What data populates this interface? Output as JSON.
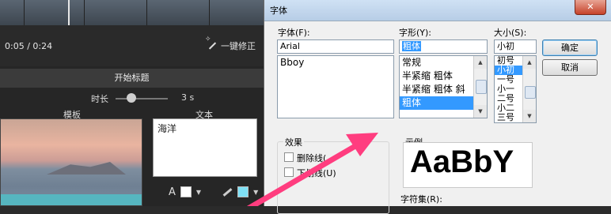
{
  "editor": {
    "time": "0:05 / 0:24",
    "auto_fix": "一键修正",
    "title_panel": "开始标题",
    "duration_label": "时长",
    "duration_value": "3 s",
    "slider_fraction": 0.3,
    "template_label": "模板",
    "text_label": "文本",
    "text_content": "海洋",
    "text_color": "#ffffff",
    "bg_color": "#7fe0f5"
  },
  "dialog": {
    "title": "字体",
    "close": "✕",
    "font_label": "字体(F):",
    "font_value": "Arial",
    "font_list": [
      "Bboy"
    ],
    "style_label": "字形(Y):",
    "style_value": "粗体",
    "style_list": [
      "常规",
      "半紧缩 粗体",
      "半紧缩 粗体 斜",
      "粗体"
    ],
    "style_selected": 3,
    "size_label": "大小(S):",
    "size_value": "小初",
    "size_list": [
      "初号",
      "小初",
      "一号",
      "小一",
      "二号",
      "小二",
      "三号"
    ],
    "size_selected": 1,
    "ok": "确定",
    "cancel": "取消",
    "effects_label": "效果",
    "strike": "删除线(",
    "underline": "下划线(U)",
    "sample_label": "示例",
    "sample_text": "AaBbY",
    "charset_label": "字符集(R):"
  },
  "colors": {
    "accent": "#3399ff",
    "arrow": "#ff3d7f"
  }
}
